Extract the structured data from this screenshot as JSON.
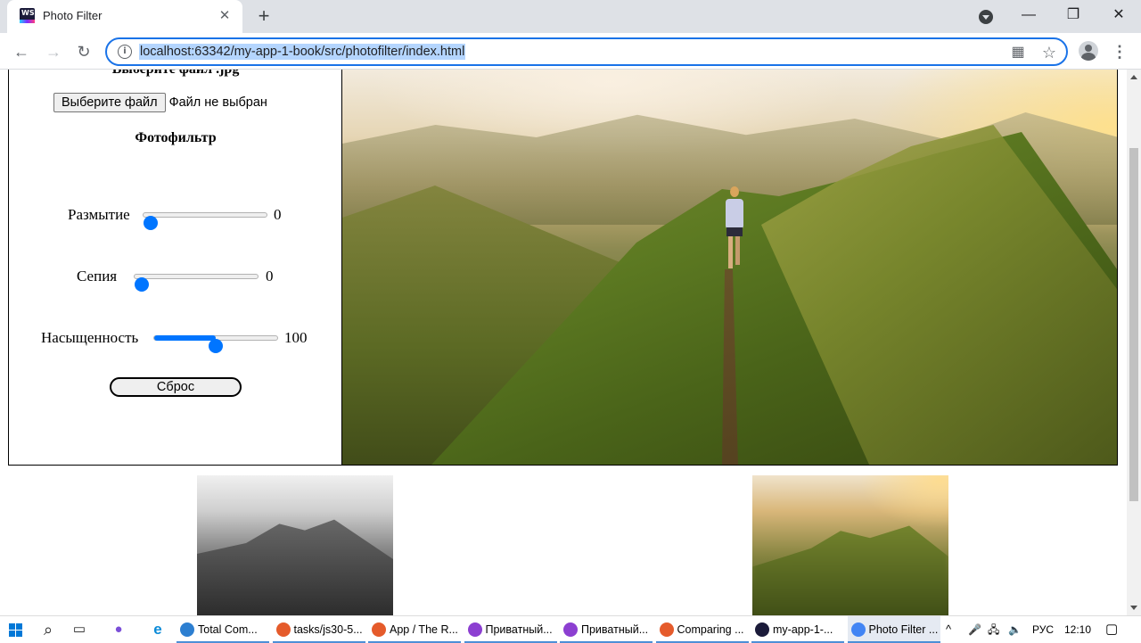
{
  "browser": {
    "tab_title": "Photo Filter",
    "tab_favicon": "WS",
    "url": "localhost:63342/my-app-1-book/src/photofilter/index.html",
    "icons": {
      "close": "✕",
      "new_tab": "+",
      "back": "←",
      "forward": "→",
      "reload": "↻",
      "minimize": "—",
      "restore": "❐",
      "window_close": "✕",
      "info": "i",
      "qr": "▦",
      "star": "☆",
      "menu": "⋮"
    }
  },
  "page": {
    "hidden_heading": "Выберите файл .jpg",
    "file_button": "Выберите файл",
    "file_status": "Файл не выбран",
    "filter_title": "Фотофильтр",
    "sliders": [
      {
        "label": "Размытие",
        "value": "0",
        "fraction": 0
      },
      {
        "label": "Сепия",
        "value": "0",
        "fraction": 0
      },
      {
        "label": "Насыщенность",
        "value": "100",
        "fraction": 0.5
      }
    ],
    "reset_button": "Сброс",
    "accent_color": "#0075ff"
  },
  "taskbar": {
    "apps": [
      {
        "label": "Total Com...",
        "color": "#2d7fd1",
        "active": false
      },
      {
        "label": "tasks/js30-5...",
        "color": "#e55b2b",
        "active": false
      },
      {
        "label": "App / The R...",
        "color": "#e55b2b",
        "active": false
      },
      {
        "label": "Приватный...",
        "color": "#8c3fd1",
        "active": false
      },
      {
        "label": "Приватный...",
        "color": "#8c3fd1",
        "active": false
      },
      {
        "label": "Comparing ...",
        "color": "#e55b2b",
        "active": false
      },
      {
        "label": "my-app-1-...",
        "color": "#1b1b3a",
        "active": false
      },
      {
        "label": "Photo Filter ...",
        "color": "#4285f4",
        "active": true
      }
    ],
    "language": "РУС",
    "time": "12:10",
    "icons": {
      "search": "⌕",
      "task_view": "▭",
      "mic": "●",
      "edge": "e",
      "chevron_up": "^",
      "notifications": "▢"
    }
  }
}
